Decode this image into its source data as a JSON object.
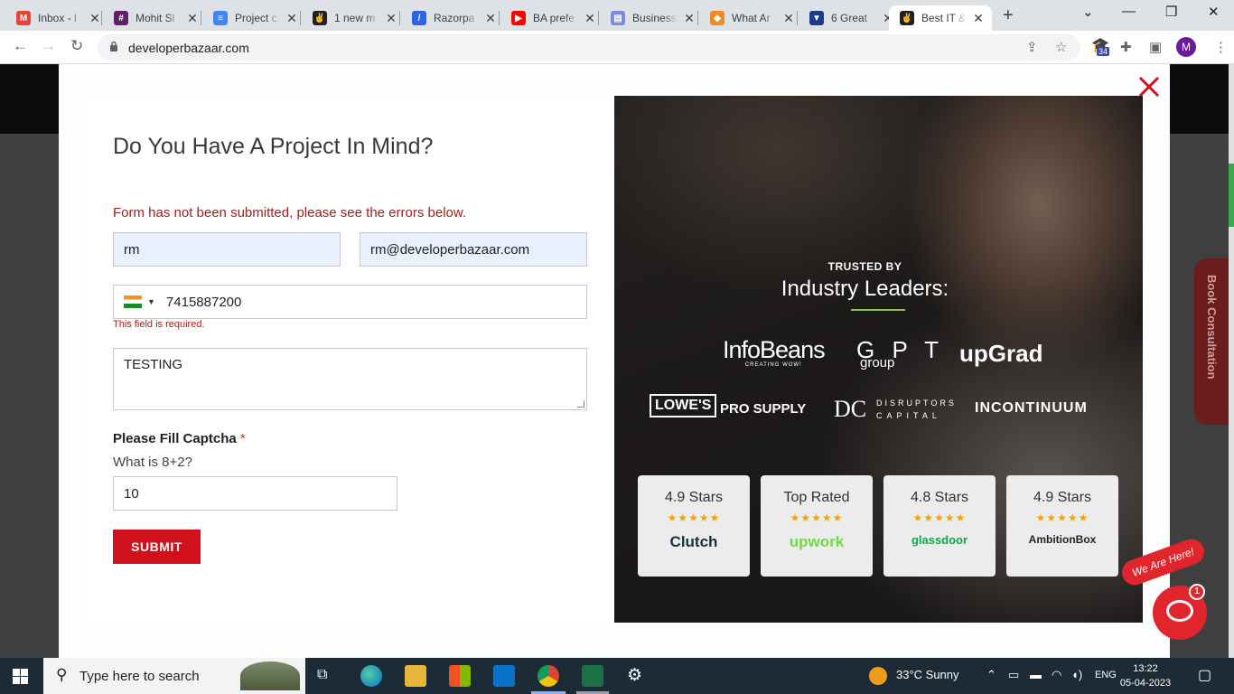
{
  "browser": {
    "tabs": [
      {
        "title": "Inbox - l",
        "icon": "gmail-icon",
        "color": "#ea4335",
        "fav": "M"
      },
      {
        "title": "Mohit Sl",
        "icon": "slack-icon",
        "color": "#611f69",
        "fav": "#"
      },
      {
        "title": "Project c",
        "icon": "docs-icon",
        "color": "#4285f4",
        "fav": "≡"
      },
      {
        "title": "1 new m",
        "icon": "site-icon",
        "color": "#222222",
        "fav": "✌"
      },
      {
        "title": "Razorpa",
        "icon": "razorpay-icon",
        "color": "#2b64e8",
        "fav": "/"
      },
      {
        "title": "BA prefe",
        "icon": "youtube-icon",
        "color": "#ff0000",
        "fav": "▶"
      },
      {
        "title": "Business",
        "icon": "doc-icon",
        "color": "#7b8ce0",
        "fav": "▤"
      },
      {
        "title": "What Ar",
        "icon": "site-icon",
        "color": "#f08a24",
        "fav": "◆"
      },
      {
        "title": "6 Great",
        "icon": "site-icon",
        "color": "#1a3e8c",
        "fav": "▼"
      },
      {
        "title": "Best IT &",
        "icon": "site-icon",
        "color": "#222222",
        "fav": "✌"
      }
    ],
    "address": "developerbazaar.com",
    "extension_badge": "34",
    "profile_initial": "M"
  },
  "form": {
    "title": "Do You Have A Project In Mind?",
    "error_message": "Form has not been submitted, please see the errors below.",
    "name_value": "rm",
    "email_value": "rm@developerbazaar.com",
    "phone_value": "7415887200",
    "phone_error": "This field is required.",
    "message_value": "TESTING",
    "captcha_label": "Please Fill Captcha",
    "captcha_required": "*",
    "captcha_question": "What is 8+2?",
    "captcha_value": "10",
    "submit_label": "SUBMIT"
  },
  "promo": {
    "trusted_by": "TRUSTED BY",
    "industry": "Industry Leaders:",
    "logos": {
      "infobeans": "InfoBeans",
      "infobeans_sub": "CREATING WOW!",
      "gpt": "G P T",
      "gpt_sub": "group",
      "upgrad": "upGrad",
      "lowes": "LOWE'S",
      "prosupply": "PRO SUPPLY",
      "dc": "DC",
      "dc_top": "DISRUPTORS",
      "dc_bottom": "CAPITAL",
      "incontinuum": "INCONTINUUM"
    },
    "cards": [
      {
        "label": "4.9 Stars",
        "brand": "Clutch",
        "stars": "★★★★★"
      },
      {
        "label": "Top Rated",
        "brand": "upwork",
        "stars": "★★★★★"
      },
      {
        "label": "4.8 Stars",
        "brand": "glassdoor",
        "stars": "★★★★★"
      },
      {
        "label": "4.9 Stars",
        "brand": "AmbitionBox",
        "stars": "★★★★★"
      }
    ]
  },
  "side_tab": "Book Consultation",
  "chat": {
    "badge": "1",
    "banner": "We Are Here!"
  },
  "taskbar": {
    "search_placeholder": "Type here to search",
    "weather": "33°C  Sunny",
    "lang": "ENG",
    "time": "13:22",
    "date": "05-04-2023"
  },
  "colors": {
    "accent": "#d0111b",
    "error": "#a3201c",
    "green": "#8bc34a",
    "star": "#f0a600"
  }
}
